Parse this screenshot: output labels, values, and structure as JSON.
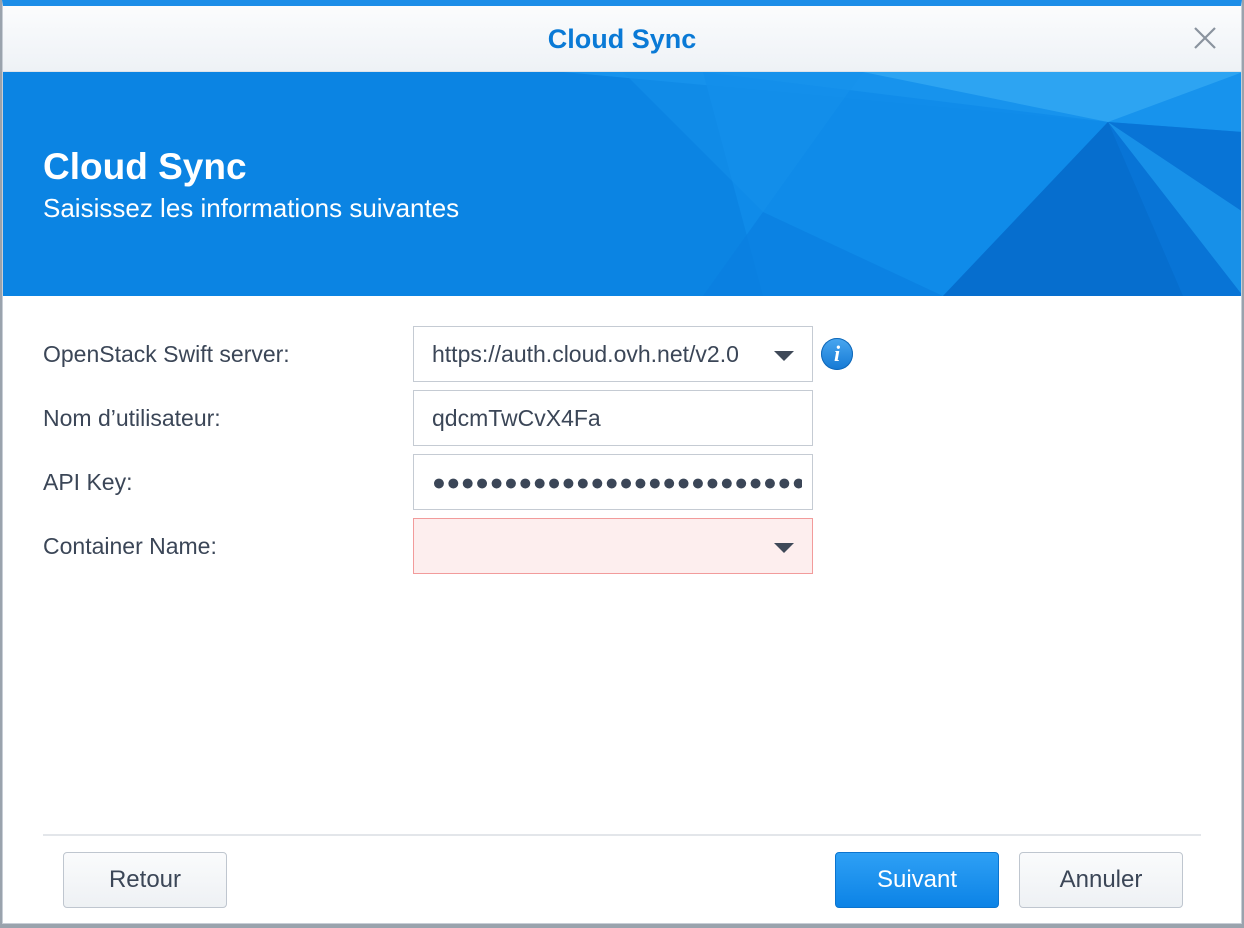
{
  "window": {
    "title": "Cloud Sync",
    "close_icon": "close-icon"
  },
  "banner": {
    "title": "Cloud Sync",
    "subtitle": "Saisissez les informations suivantes"
  },
  "form": {
    "server": {
      "label": "OpenStack Swift server:",
      "value": "https://auth.cloud.ovh.net/v2.0"
    },
    "username": {
      "label": "Nom d’utilisateur:",
      "value": "qdcmTwCvX4Fa"
    },
    "api_key": {
      "label": "API Key:",
      "value": "●●●●●●●●●●●●●●●●●●●●●●●●●●●●●●●●"
    },
    "container": {
      "label": "Container Name:",
      "value": ""
    },
    "info_icon_glyph": "i"
  },
  "buttons": {
    "back": "Retour",
    "next": "Suivant",
    "cancel": "Annuler"
  },
  "colors": {
    "accent": "#1c8ee8",
    "title_text": "#0a7ad6",
    "error_field": "#fdeeee",
    "error_border": "#f29b9b"
  }
}
